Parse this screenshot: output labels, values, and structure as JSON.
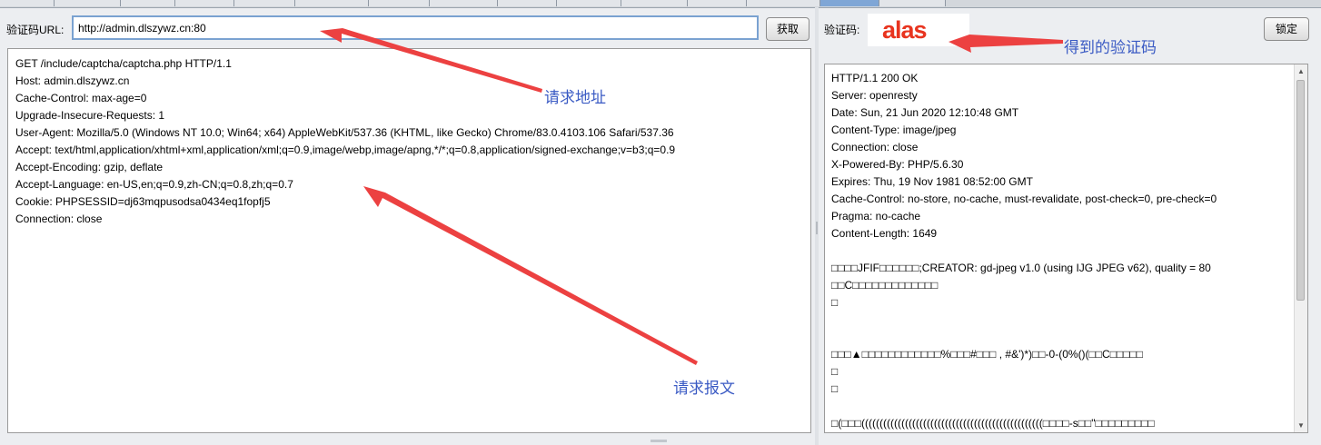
{
  "left": {
    "url_label": "验证码URL:",
    "url_value": "http://admin.dlszywz.cn:80",
    "fetch_button": "获取",
    "request_lines": [
      "GET /include/captcha/captcha.php HTTP/1.1",
      "Host: admin.dlszywz.cn",
      "Cache-Control: max-age=0",
      "Upgrade-Insecure-Requests: 1",
      "User-Agent: Mozilla/5.0 (Windows NT 10.0; Win64; x64) AppleWebKit/537.36 (KHTML, like Gecko) Chrome/83.0.4103.106 Safari/537.36",
      "Accept: text/html,application/xhtml+xml,application/xml;q=0.9,image/webp,image/apng,*/*;q=0.8,application/signed-exchange;v=b3;q=0.9",
      "Accept-Encoding: gzip, deflate",
      "Accept-Language: en-US,en;q=0.9,zh-CN;q=0.8,zh;q=0.7",
      "Cookie: PHPSESSID=dj63mqpusodsa0434eq1fopfj5",
      "Connection: close"
    ]
  },
  "right": {
    "captcha_label": "验证码:",
    "captcha_text": "alas",
    "lock_button": "锁定",
    "response_lines": [
      "HTTP/1.1 200 OK",
      "Server: openresty",
      "Date: Sun, 21 Jun 2020 12:10:48 GMT",
      "Content-Type: image/jpeg",
      "Connection: close",
      "X-Powered-By: PHP/5.6.30",
      "Expires: Thu, 19 Nov 1981 08:52:00 GMT",
      "Cache-Control: no-store, no-cache, must-revalidate, post-check=0, pre-check=0",
      "Pragma: no-cache",
      "Content-Length: 1649",
      "",
      "□□□□JFIF□□□□□□;CREATOR: gd-jpeg v1.0 (using IJG JPEG v62), quality = 80",
      "□□C□□□□□□□□□□□□□",
      "□",
      "",
      "",
      "□□□▲□□□□□□□□□□□□%□□□#□□□ , #&')*)□□-0-(0%()(□□C□□□□□",
      "□",
      "□",
      "",
      "□(□□□((((((((((((((((((((((((((((((((((((((((((((((((((□□□□-s□□\"□□□□□□□□□"
    ]
  },
  "annotations": {
    "request_url": "请求地址",
    "request_message": "请求报文",
    "captcha_result": "得到的验证码",
    "color": "#ec4141",
    "text_color": "#3b5bc4"
  },
  "colors": {
    "captcha_text": "#e8341f",
    "url_border": "#7aa2d1",
    "window_bg": "#eceef1"
  }
}
